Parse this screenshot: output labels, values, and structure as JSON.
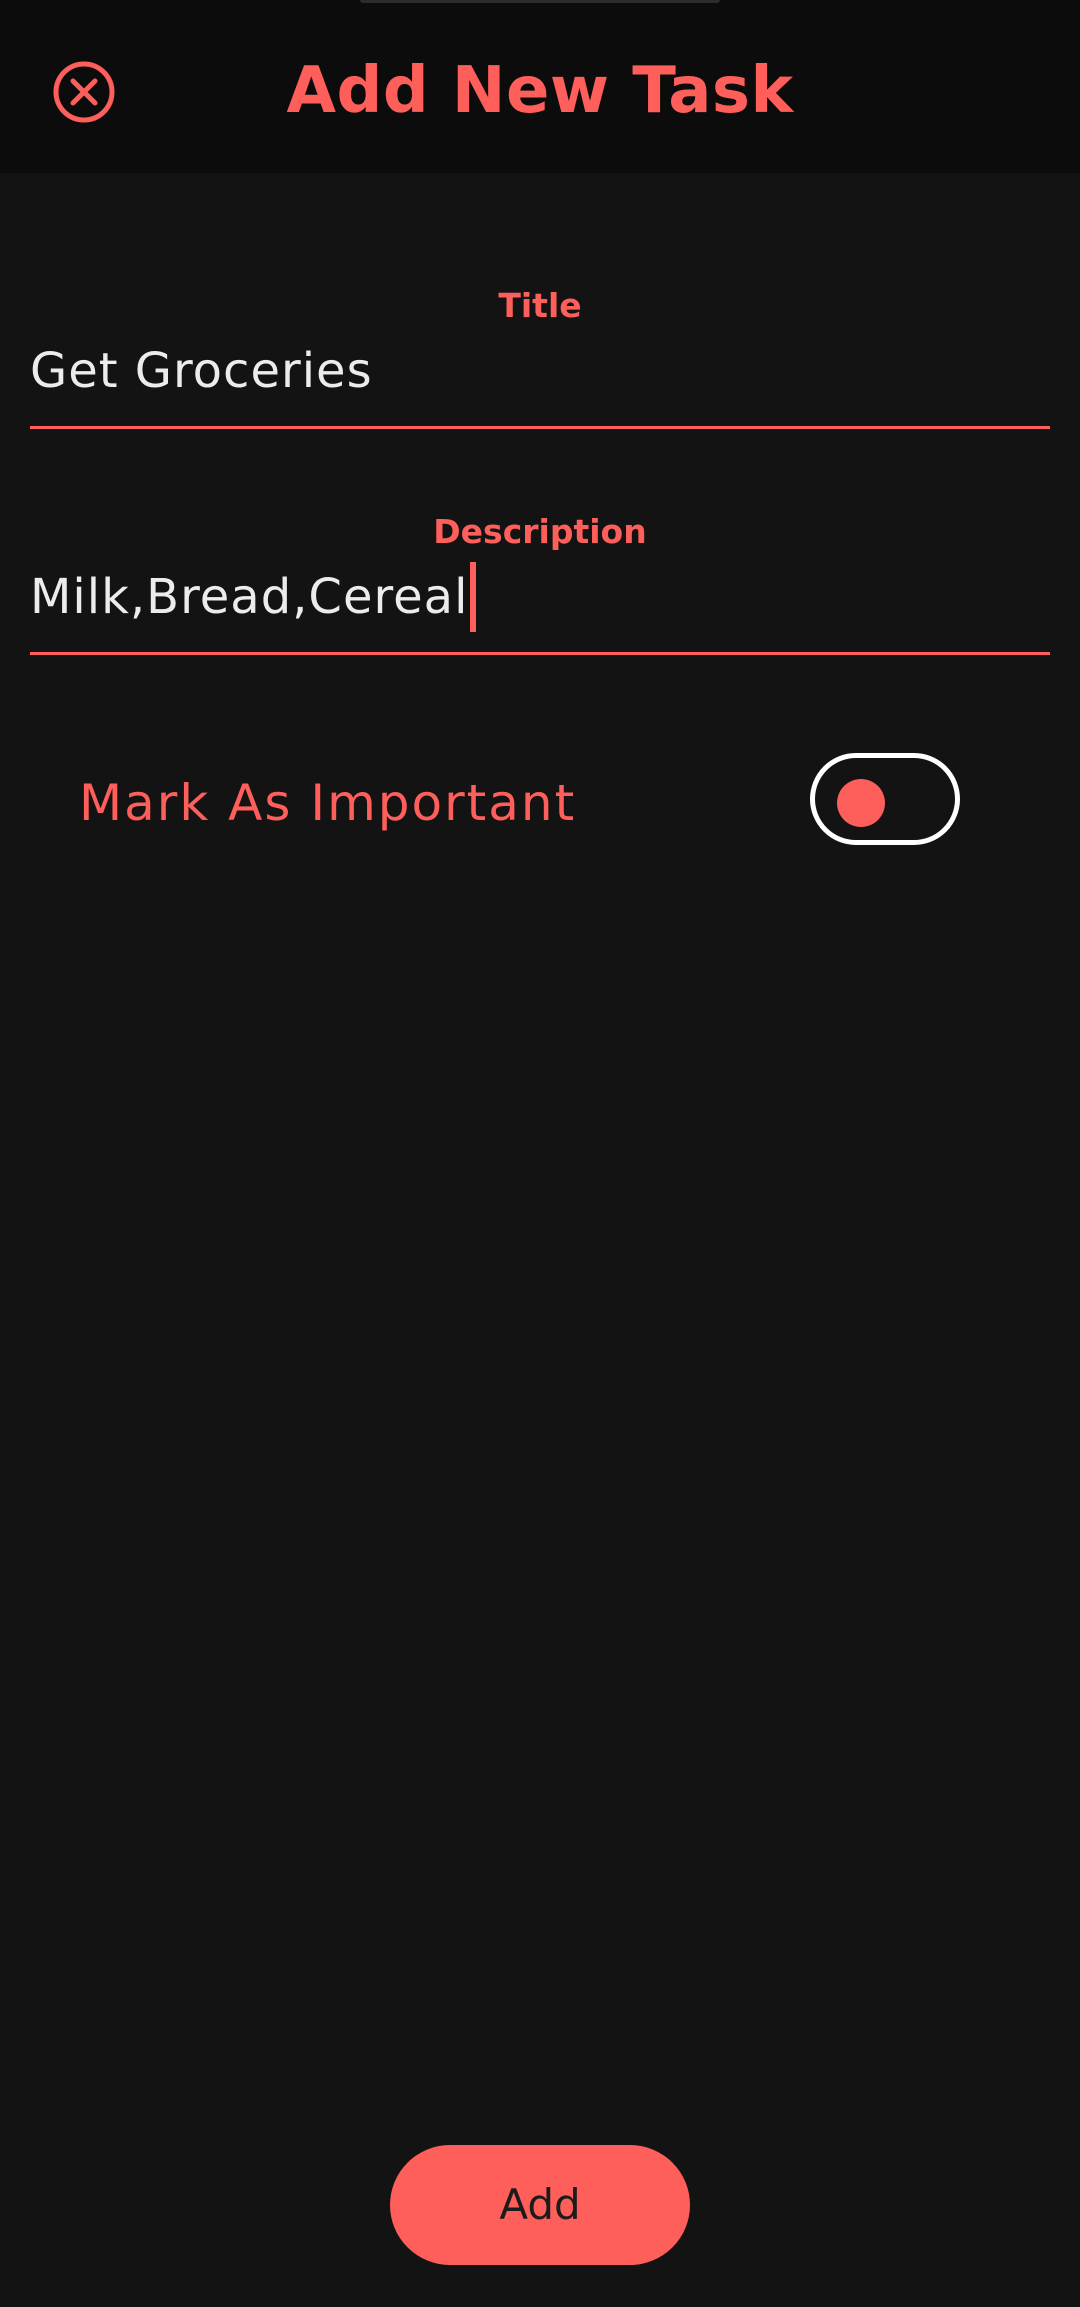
{
  "header": {
    "title": "Add New Task",
    "close_icon": "close-circle-icon"
  },
  "form": {
    "title": {
      "label": "Title",
      "value": "Get Groceries"
    },
    "description": {
      "label": "Description",
      "value": "Milk,Bread,Cereal"
    },
    "important": {
      "label": "Mark As Important",
      "checked": false
    }
  },
  "actions": {
    "add_label": "Add"
  },
  "colors": {
    "accent": "#ff5f5a",
    "background": "#131313",
    "appbar": "#0c0c0c",
    "text": "#ececec",
    "toggle_border": "#ffffff"
  }
}
